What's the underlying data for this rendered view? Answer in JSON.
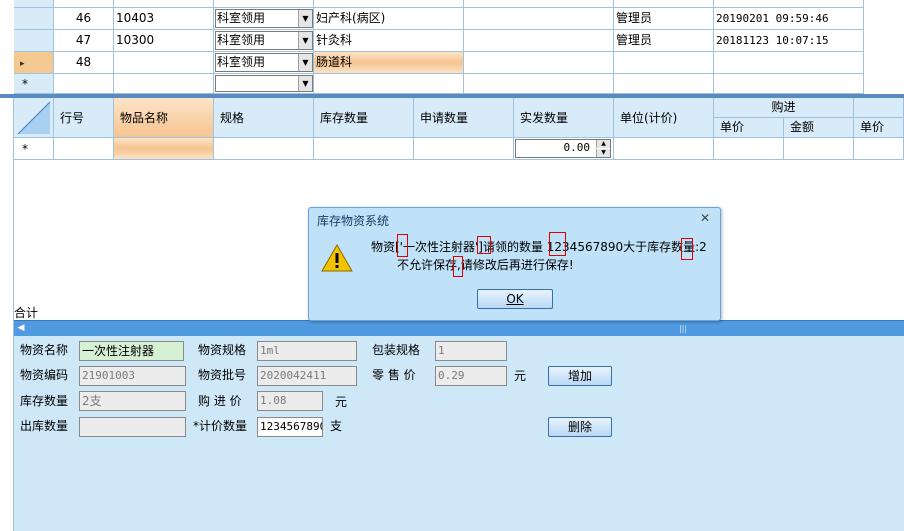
{
  "top_grid": {
    "rows": [
      {
        "seq": "46",
        "code": "10403",
        "type": "科室领用",
        "dept": "妇产科(病区)",
        "user": "管理员",
        "time": "20190201 09:59:46"
      },
      {
        "seq": "47",
        "code": "10300",
        "type": "科室领用",
        "dept": "针灸科",
        "user": "管理员",
        "time": "20181123 10:07:15"
      },
      {
        "seq": "48",
        "code": "",
        "type": "科室领用",
        "dept": "肠道科",
        "user": "",
        "time": ""
      },
      {
        "seq": "",
        "code": "",
        "type": "",
        "dept": "",
        "user": "",
        "time": ""
      }
    ],
    "current_marker": "▸",
    "new_marker": "*"
  },
  "detail_grid": {
    "headers": {
      "row_no": "行号",
      "item_name": "物品名称",
      "spec": "规格",
      "stock_qty": "库存数量",
      "apply_qty": "申请数量",
      "issue_qty": "实发数量",
      "unit": "单位(计价)",
      "purchase_group": "购进",
      "purchase_unit_price": "单价",
      "purchase_amount": "金额",
      "retail_unit_price": "单价"
    },
    "new_row_marker": "*",
    "issue_qty_value": "0.00",
    "total_label": "合计"
  },
  "form": {
    "material_name_label": "物资名称",
    "material_name": "一次性注射器",
    "material_spec_label": "物资规格",
    "material_spec": "1ml",
    "pack_spec_label": "包装规格",
    "pack_spec": "1",
    "material_code_label": "物资编码",
    "material_code": "21901003",
    "batch_no_label": "物资批号",
    "batch_no": "2020042411",
    "retail_price_label": "零 售 价",
    "retail_price": "0.29",
    "yuan": "元",
    "add_button": "增加",
    "stock_qty_label": "库存数量",
    "stock_qty": "2支",
    "purchase_price_label": "购 进 价",
    "purchase_price": "1.08",
    "yuan2": "元",
    "out_qty_label": "出库数量",
    "out_qty": "",
    "price_qty_label": "*计价数量",
    "price_qty": "1234567890",
    "unit_zhi": "支",
    "delete_button": "删除"
  },
  "dialog": {
    "title": "库存物资系统",
    "close": "✕",
    "message_line1": "物资['一次性注射器']请领的数量 1234567890大于库存数量:2",
    "message_line2": "不允许保存,请修改后再进行保存!",
    "ok_button": "OK"
  },
  "colors": {
    "grid_header": "#d8ebf9",
    "selection": "#f7c48f",
    "form_background": "#cfe8f8",
    "dialog_background": "#bfe2f9",
    "scrollbar": "#4f9ae0"
  }
}
